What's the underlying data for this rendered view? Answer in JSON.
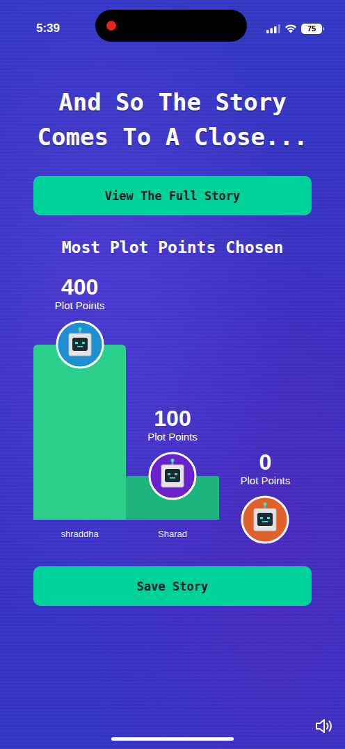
{
  "status_bar": {
    "time": "5:39",
    "battery": "75",
    "recording": true
  },
  "title": "And So The Story Comes To A Close...",
  "buttons": {
    "view": "View The Full Story",
    "save": "Save Story"
  },
  "chart": {
    "title": "Most Plot Points Chosen",
    "unit": "Plot Points",
    "values": [
      400,
      100,
      0
    ],
    "players": [
      {
        "name": "shraddha",
        "value": "400",
        "color": "#1e8fd0"
      },
      {
        "name": "Sharad",
        "value": "100",
        "color": "#6a22cc"
      },
      {
        "value": "0",
        "color": "#e0622a"
      }
    ]
  }
}
